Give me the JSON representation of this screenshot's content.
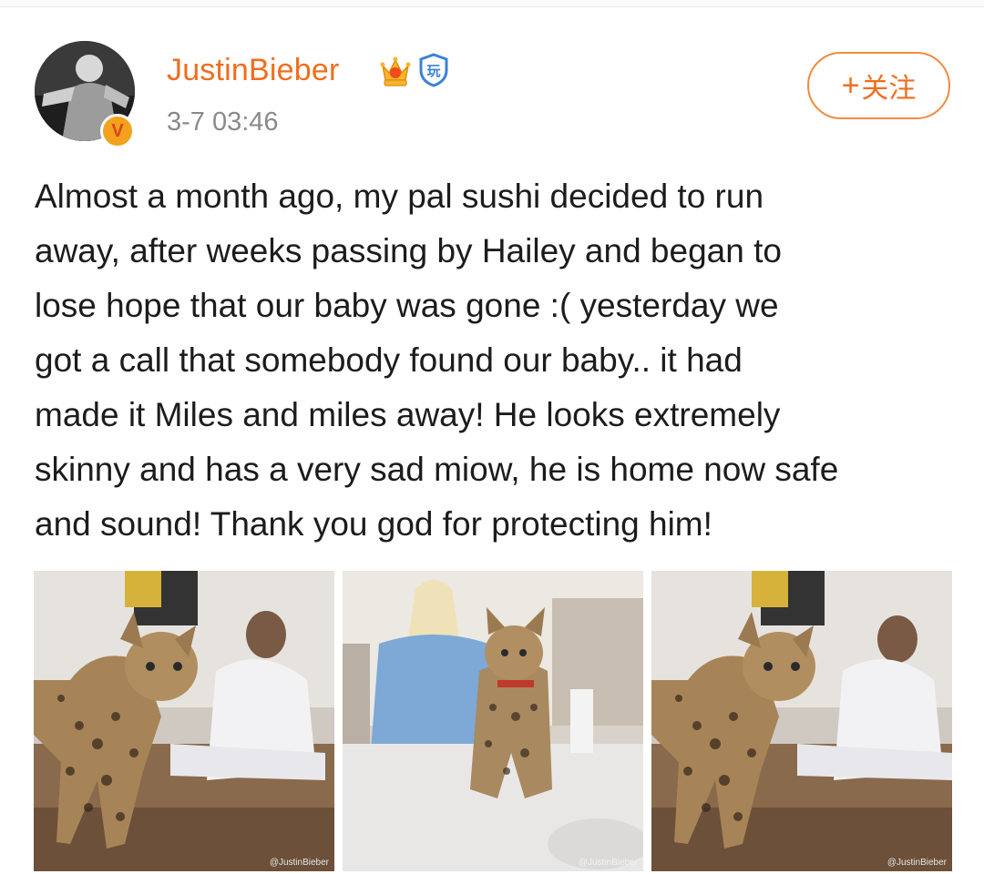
{
  "user": {
    "name": "JustinBieber",
    "timestamp": "3-7 03:46",
    "verified_badge": "V",
    "crown_icon": "crown-icon",
    "shield_badge_text": "玩"
  },
  "actions": {
    "follow_plus": "+",
    "follow_label": "关注"
  },
  "post": {
    "lines": [
      "Almost a month ago, my pal sushi decided to run",
      "away, after weeks passing by Hailey and began to",
      "lose hope that our baby was gone :( yesterday we",
      "got a call that somebody found our baby.. it had",
      "made it Miles and miles away! He looks extremely",
      "skinny and has a very sad miow, he is home now safe",
      "and sound! Thank you god for protecting him!"
    ]
  },
  "photos": [
    {
      "watermark": "@JustinBieber"
    },
    {
      "watermark": "@JustinBieber"
    },
    {
      "watermark": "@JustinBieber"
    }
  ],
  "colors": {
    "accent": "#f26d1e",
    "timestamp": "#8a8a8a",
    "badge": "#f2a21c"
  }
}
